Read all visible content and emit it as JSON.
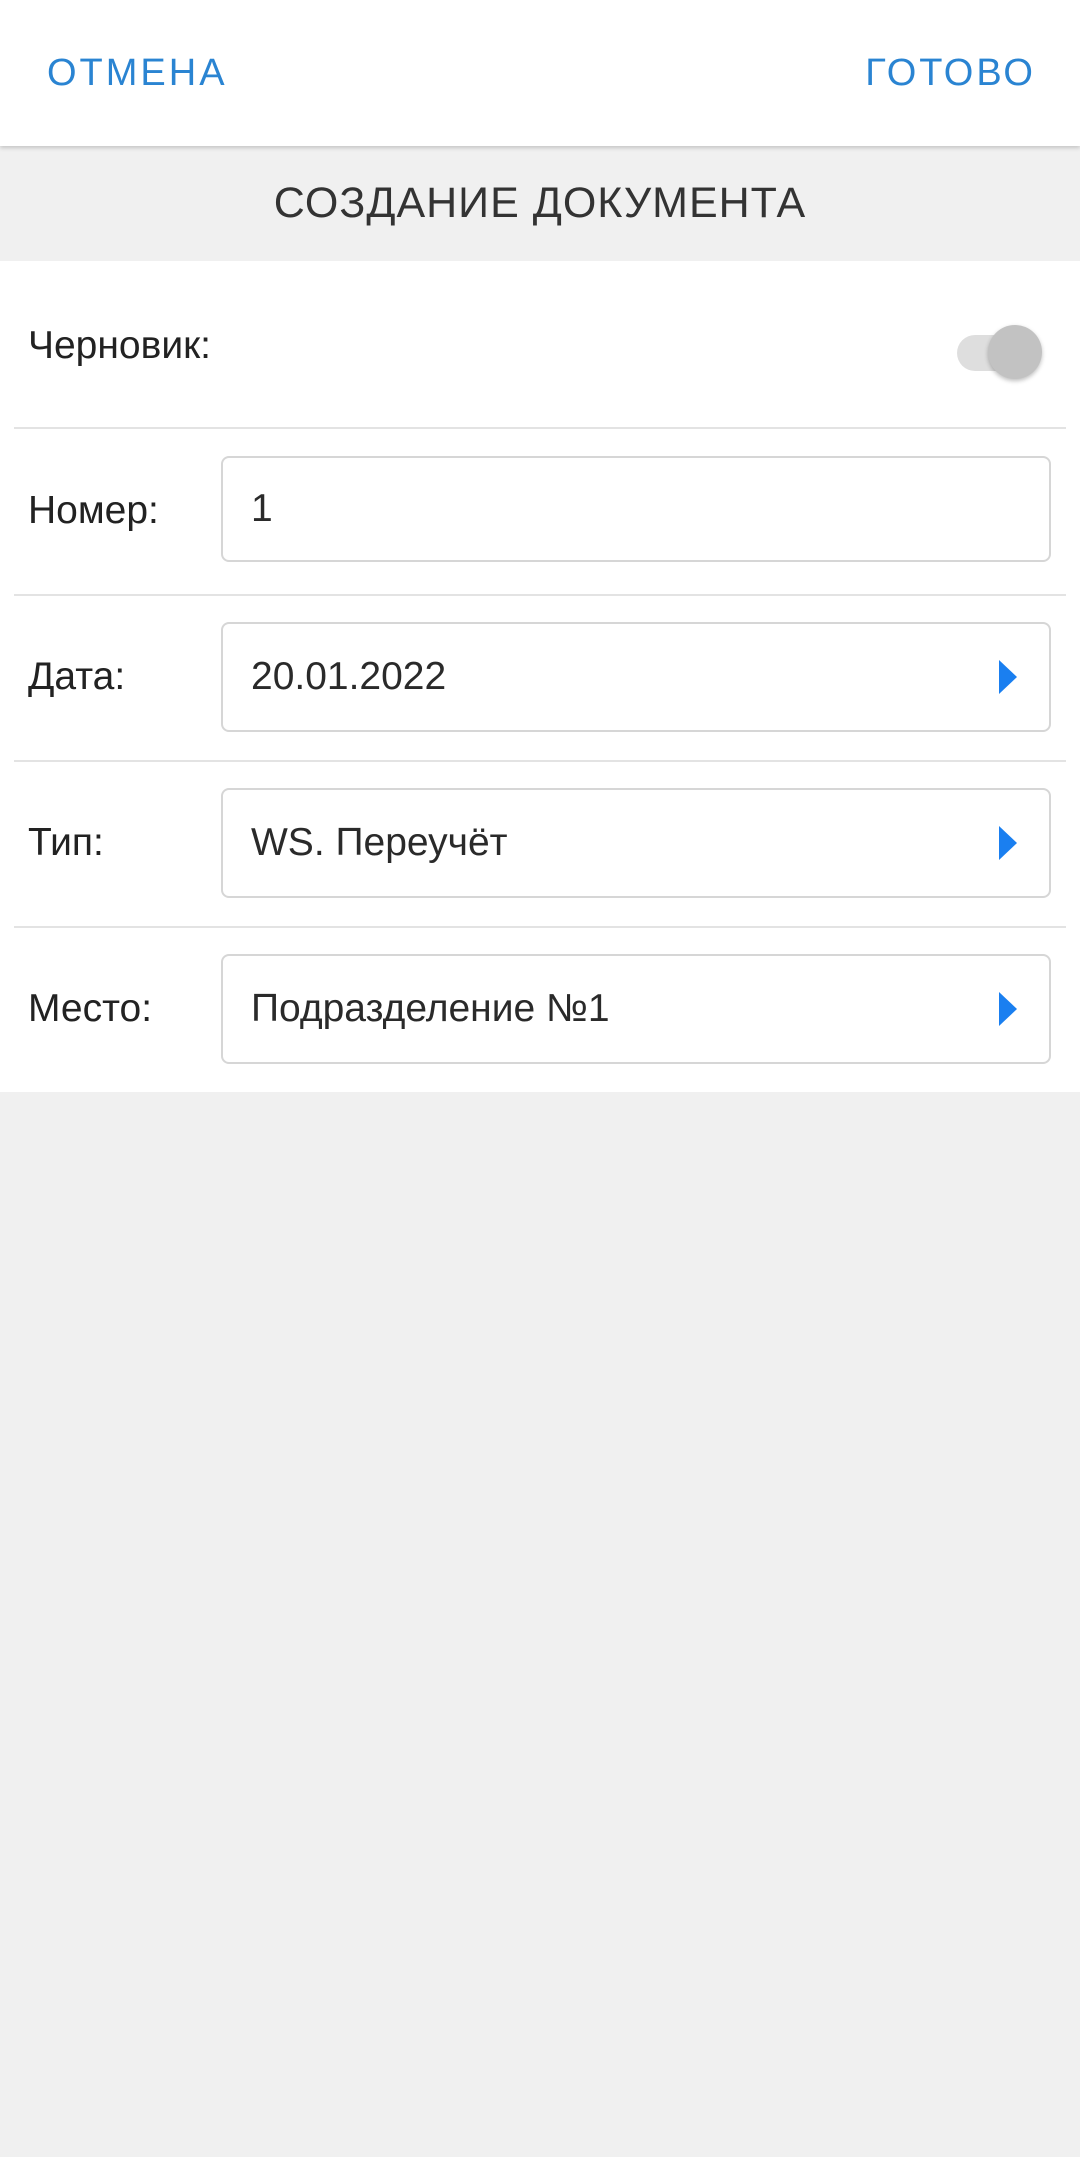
{
  "header": {
    "cancel_label": "ОТМЕНА",
    "done_label": "ГОТОВО"
  },
  "page": {
    "title": "СОЗДАНИЕ ДОКУМЕНТА"
  },
  "form": {
    "draft": {
      "label": "Черновик:",
      "enabled": false
    },
    "number": {
      "label": "Номер:",
      "value": "1"
    },
    "date": {
      "label": "Дата:",
      "value": "20.01.2022"
    },
    "type": {
      "label": "Тип:",
      "value": "WS. Переучёт"
    },
    "place": {
      "label": "Место:",
      "value": "Подразделение №1"
    }
  },
  "colors": {
    "accent": "#2a84d2",
    "arrow": "#1a7ff0",
    "background": "#f0f0f0"
  },
  "icons": {
    "select_arrow": "chevron-right-icon"
  }
}
